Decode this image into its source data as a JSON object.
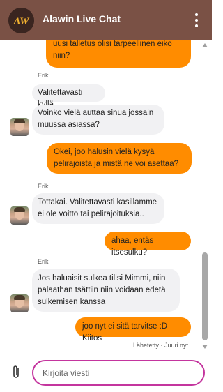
{
  "header": {
    "title": "Alawin Live Chat",
    "logo_text": "AW"
  },
  "messages": [
    {
      "from": "me",
      "text": "uusi talletus olisi tarpeellinen eiko niin?"
    },
    {
      "from": "them",
      "sender": "Erik",
      "text": "Valitettavasti kyllä"
    },
    {
      "from": "them",
      "text": "Voinko vielä auttaa sinua jossain muussa asiassa?"
    },
    {
      "from": "me",
      "text": "Okei, joo halusin vielä kysyä pelirajoista ja mistä ne voi asettaa?"
    },
    {
      "from": "them",
      "sender": "Erik",
      "text": "Tottakai. Valitettavasti kasillamme ei ole voitto tai pelirajoituksia.."
    },
    {
      "from": "me",
      "text": "ahaa, entäs itsesulku?"
    },
    {
      "from": "them",
      "sender": "Erik",
      "text": "Jos haluaisit sulkea tilisi Mimmi, niin palaathan tsättiin niin voidaan edetä sulkemisen kanssa"
    },
    {
      "from": "me",
      "text": "joo nyt ei sitä tarvitse :D Kiitos"
    }
  ],
  "status": "Lähetetty · Juuri nyt",
  "composer": {
    "placeholder": "Kirjoita viesti"
  },
  "colors": {
    "header": "#7a5145",
    "my_bubble": "#ff8c00",
    "agent_bubble": "#f1f1f3",
    "input_border": "#c4359e"
  }
}
